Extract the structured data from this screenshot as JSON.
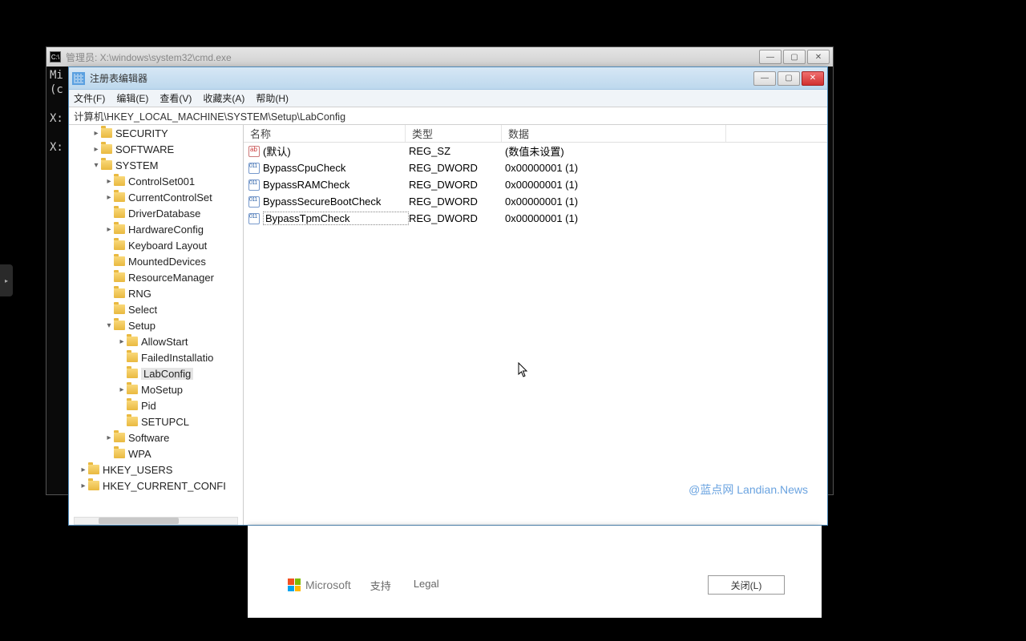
{
  "cmd": {
    "title": "管理员: X:\\windows\\system32\\cmd.exe",
    "line1": "Mi",
    "line2": "(c",
    "line3": "X:",
    "line4": "X:"
  },
  "regedit": {
    "title": "注册表编辑器",
    "menu": {
      "file": "文件(F)",
      "edit": "编辑(E)",
      "view": "查看(V)",
      "favorites": "收藏夹(A)",
      "help": "帮助(H)"
    },
    "path": "计算机\\HKEY_LOCAL_MACHINE\\SYSTEM\\Setup\\LabConfig",
    "tree": {
      "security": "SECURITY",
      "software": "SOFTWARE",
      "system": "SYSTEM",
      "items": {
        "controlset001": "ControlSet001",
        "currentcontrolset": "CurrentControlSet",
        "driverdatabase": "DriverDatabase",
        "hardwareconfig": "HardwareConfig",
        "keyboardlayout": "Keyboard Layout",
        "mounteddevices": "MountedDevices",
        "resourcemanager": "ResourceManager",
        "rng": "RNG",
        "select": "Select",
        "setup": "Setup",
        "setup_children": {
          "allowstart": "AllowStart",
          "failedinstallation": "FailedInstallatio",
          "labconfig": "LabConfig",
          "mosetup": "MoSetup",
          "pid": "Pid",
          "setupcl": "SETUPCL"
        },
        "software2": "Software",
        "wpa": "WPA"
      },
      "hkey_users": "HKEY_USERS",
      "hkey_current_config": "HKEY_CURRENT_CONFI"
    },
    "columns": {
      "name": "名称",
      "type": "类型",
      "data": "数据"
    },
    "values": [
      {
        "icon": "sz",
        "name": "(默认)",
        "type": "REG_SZ",
        "data": "(数值未设置)"
      },
      {
        "icon": "bin",
        "name": "BypassCpuCheck",
        "type": "REG_DWORD",
        "data": "0x00000001 (1)"
      },
      {
        "icon": "bin",
        "name": "BypassRAMCheck",
        "type": "REG_DWORD",
        "data": "0x00000001 (1)"
      },
      {
        "icon": "bin",
        "name": "BypassSecureBootCheck",
        "type": "REG_DWORD",
        "data": "0x00000001 (1)"
      },
      {
        "icon": "bin",
        "name": "BypassTpmCheck",
        "type": "REG_DWORD",
        "data": "0x00000001 (1)"
      }
    ],
    "watermark": "@蓝点网 Landian.News"
  },
  "wizard": {
    "brand": "Microsoft",
    "support": "支持",
    "legal": "Legal",
    "close": "关闭(L)"
  }
}
